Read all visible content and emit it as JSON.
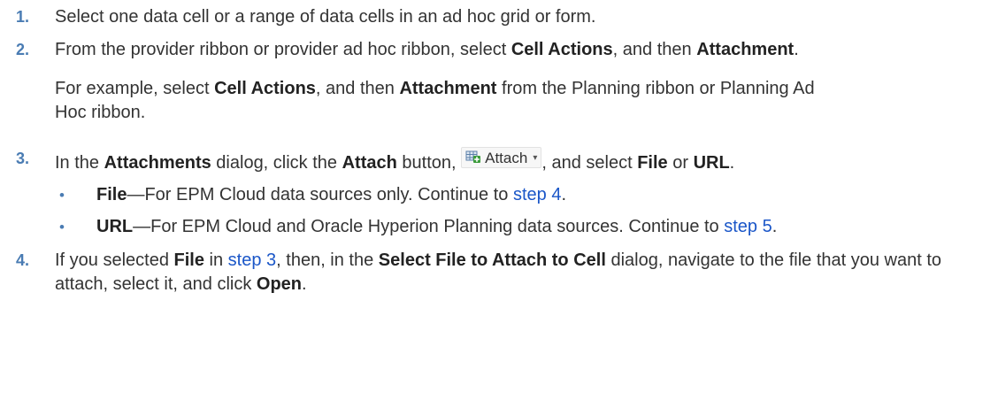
{
  "steps": [
    {
      "num": "1.",
      "parts": [
        {
          "t": "Select one data cell or a range of data cells in an ad hoc grid or form."
        }
      ]
    },
    {
      "num": "2.",
      "parts": [
        {
          "t": "From the provider ribbon or provider ad hoc ribbon, select "
        },
        {
          "t": "Cell Actions",
          "b": true
        },
        {
          "t": ", and then "
        },
        {
          "t": "Attachment",
          "b": true
        },
        {
          "t": "."
        }
      ],
      "note": [
        {
          "t": "For example, select "
        },
        {
          "t": "Cell Actions",
          "b": true
        },
        {
          "t": ", and then "
        },
        {
          "t": "Attachment",
          "b": true
        },
        {
          "t": " from the Planning ribbon or Planning Ad Hoc ribbon."
        }
      ]
    },
    {
      "num": "3.",
      "parts": [
        {
          "t": "In the "
        },
        {
          "t": "Attachments",
          "b": true
        },
        {
          "t": " dialog, click the "
        },
        {
          "t": "Attach",
          "b": true
        },
        {
          "t": " button, "
        },
        {
          "widget": "attach"
        },
        {
          "t": ", and select "
        },
        {
          "t": "File",
          "b": true
        },
        {
          "t": " or "
        },
        {
          "t": "URL",
          "b": true
        },
        {
          "t": "."
        }
      ],
      "bullets": [
        [
          {
            "t": "File",
            "b": true
          },
          {
            "t": "—For EPM Cloud data sources only. Continue to "
          },
          {
            "t": "step 4",
            "link": true
          },
          {
            "t": "."
          }
        ],
        [
          {
            "t": "URL",
            "b": true
          },
          {
            "t": "—For EPM Cloud and Oracle Hyperion Planning data sources. Continue to "
          },
          {
            "t": "step 5",
            "link": true
          },
          {
            "t": "."
          }
        ]
      ]
    },
    {
      "num": "4.",
      "parts": [
        {
          "t": "If you selected "
        },
        {
          "t": "File",
          "b": true
        },
        {
          "t": " in "
        },
        {
          "t": "step 3",
          "link": true
        },
        {
          "t": ", then, in the "
        },
        {
          "t": "Select File to Attach to Cell",
          "b": true
        },
        {
          "t": " dialog, navigate to the file that you want to attach, select it, and click "
        },
        {
          "t": "Open",
          "b": true
        },
        {
          "t": "."
        }
      ]
    }
  ],
  "attach_button": {
    "label": "Attach",
    "icon": "attach-add-icon",
    "caret": "▾"
  },
  "bullet_char": "•",
  "colors": {
    "text": "#333333",
    "step_number": "#4a7cb3",
    "link": "#1a56c8"
  }
}
